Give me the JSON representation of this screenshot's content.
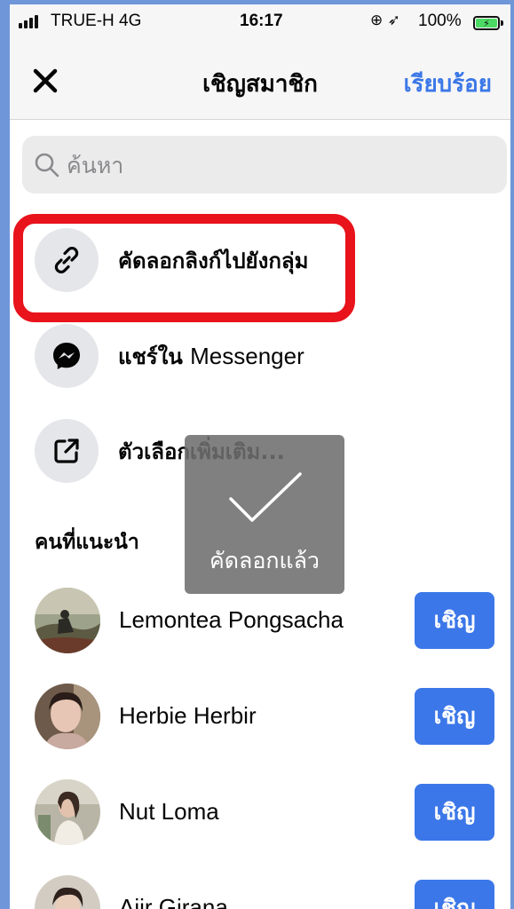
{
  "status_bar": {
    "carrier": "TRUE-H  4G",
    "time": "16:17",
    "battery_percent": "100%",
    "icons": [
      "orientation-lock-icon",
      "location-icon",
      "battery-charging-icon"
    ]
  },
  "header": {
    "title": "เชิญสมาชิก",
    "done_label": "เรียบร้อย",
    "close_icon": "close-icon"
  },
  "search": {
    "placeholder": "ค้นหา"
  },
  "options": [
    {
      "label": "คัดลอกลิงก์ไปยังกลุ่ม",
      "icon": "link-icon"
    },
    {
      "label_th": "แชร์ใน ",
      "label_en": "Messenger",
      "icon": "messenger-icon"
    },
    {
      "label": "ตัวเลือกเพิ่มเติม...",
      "icon": "external-share-icon"
    }
  ],
  "suggested": {
    "title": "คนที่แนะนำ",
    "people": [
      {
        "name": "Lemontea Pongsacha",
        "invite_label": "เชิญ"
      },
      {
        "name": "Herbie Herbir",
        "invite_label": "เชิญ"
      },
      {
        "name": "Nut Loma",
        "invite_label": "เชิญ"
      },
      {
        "name": "Aiir Girana",
        "invite_label": "เชิญ"
      }
    ]
  },
  "toast": {
    "text": "คัดลอกแล้ว",
    "icon": "checkmark-icon"
  },
  "colors": {
    "accent": "#3b77e8",
    "highlight": "#e8131b",
    "toast_bg": "#6e6e6e"
  }
}
